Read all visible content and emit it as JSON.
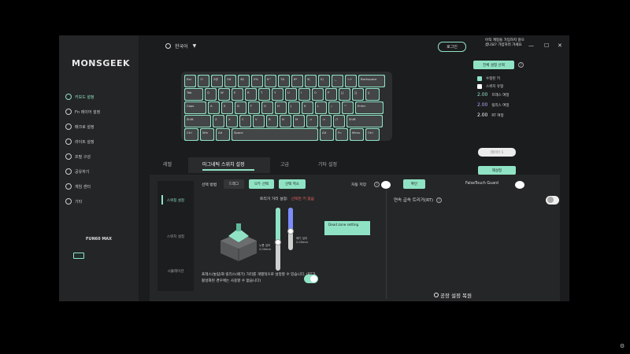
{
  "app": {
    "logo": "MONSGEEK"
  },
  "sidebar": {
    "items": [
      {
        "label": "키보드 설정",
        "icon": "keyboard-settings-icon",
        "active": true
      },
      {
        "label": "Fn 레이어 설정",
        "icon": "fn-layer-icon",
        "active": false
      },
      {
        "label": "매크로 설정",
        "icon": "macro-icon",
        "active": false
      },
      {
        "label": "라이트 설정",
        "icon": "light-icon",
        "active": false
      },
      {
        "label": "프필 구성",
        "icon": "profile-icon",
        "active": false
      },
      {
        "label": "공유하기",
        "icon": "share-icon",
        "active": false
      },
      {
        "label": "게임 센터",
        "icon": "game-center-icon",
        "active": false
      },
      {
        "label": "기타",
        "icon": "other-icon",
        "active": false
      }
    ],
    "device_name": "FUN60 MAX"
  },
  "header": {
    "language": "한국어",
    "login_label": "로그인",
    "promo_text": "아직 계정을 가입하지 않으셨나요? 가입하러 가세요",
    "win_min": "—",
    "win_max": "☐",
    "win_close": "✕"
  },
  "keyboard": {
    "rows": [
      [
        "Esc",
        "1!",
        "2@",
        "3#",
        "4$",
        "5%",
        "6^",
        "7&",
        "8*",
        "9(",
        "0)",
        "-_",
        "=+",
        "Backspace"
      ],
      [
        "Tab",
        "Q",
        "W",
        "E",
        "R",
        "T",
        "Y",
        "U",
        "I",
        "O",
        "P",
        "[{",
        "]}",
        "\\|"
      ],
      [
        "Caps",
        "A",
        "S",
        "D",
        "F",
        "G",
        "H",
        "J",
        "K",
        "L",
        ";:",
        "'\"",
        "Enter"
      ],
      [
        "Shift",
        "Z",
        "X",
        "C",
        "V",
        "B",
        "N",
        "M",
        ",<",
        ".>",
        "/?",
        "Shift"
      ],
      [
        "Ctrl",
        "Win",
        "Alt",
        "Space",
        "Alt",
        "Fn",
        "Menu",
        "Ctrl"
      ]
    ]
  },
  "right_panel": {
    "select_all_label": "전체 설정 선택",
    "legend": [
      {
        "label": "수정된 키",
        "color": "#8fe3c4"
      },
      {
        "label": "스위치 유형",
        "color": "#ffffff"
      }
    ],
    "stats": [
      {
        "value": "2.00",
        "label": "프레스 여정",
        "color": "#8fe3c4"
      },
      {
        "value": "2.00",
        "label": "릴리스 여정",
        "color": "#b8a6ff"
      },
      {
        "value": "2.00",
        "label": "RT 여정",
        "color": "#ffffff"
      }
    ],
    "layer_select": "레이어 1",
    "apply_label": "재설정",
    "switch_calibrate_label": "스위치 교정"
  },
  "tabs": [
    {
      "label": "레벨",
      "active": false
    },
    {
      "label": "마그네틱 스위치 설정",
      "active": true
    },
    {
      "label": "고급",
      "active": false
    },
    {
      "label": "기타 설정",
      "active": false
    }
  ],
  "panel": {
    "subnav": [
      {
        "label": "스위칭 설정",
        "active": true
      },
      {
        "label": "스위치 설정",
        "active": false
      },
      {
        "label": "시뮬레이션",
        "active": false
      }
    ],
    "toolbar": {
      "select_method": "선택 방법",
      "drag_label": "드래그",
      "select_all": "모두 선택",
      "deselect": "선택 취소",
      "auto_save": "자동 저장",
      "confirm": "확인",
      "falsetouch": "FalseTouch Guard"
    },
    "trigger": {
      "title": "트리거 거리 설정:",
      "value": "선택된 키 없음"
    },
    "sliders": {
      "press_label": "누름 깊이",
      "press_value": "2.00mm",
      "press_level": 0.55,
      "release_label": "떼기 깊이",
      "release_value": "2.00mm",
      "release_level": 0.55
    },
    "deadzone_label": "Dead zone setting",
    "description": "프레스(눌림)와 릴리스(떼기) 거리를 개별적으로 설정할 수 있습니다. (RT가 활성화된 경우에는 사용할 수 없습니다)",
    "rapid_trigger_title": "연속 급속 트리거(RT)",
    "factory_reset": "공장 설정 복원"
  }
}
